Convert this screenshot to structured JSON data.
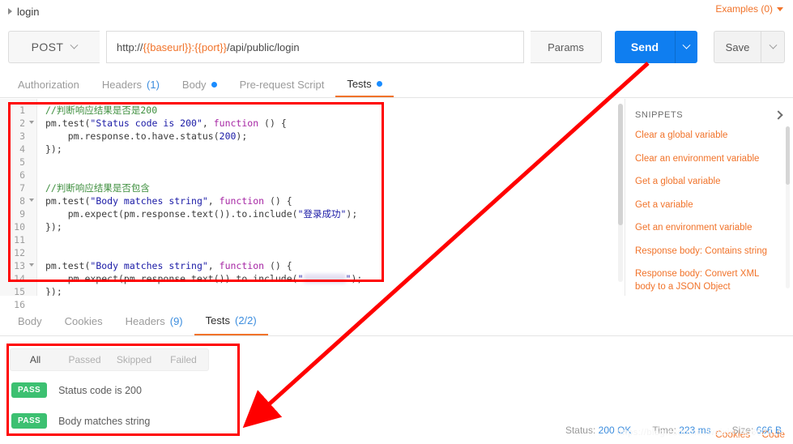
{
  "breadcrumb": {
    "label": "login",
    "caret_icon": "triangle-right-icon"
  },
  "examples": {
    "label": "Examples (0)",
    "caret_icon": "chevron-down-icon"
  },
  "request": {
    "method": "POST",
    "url_prefix": "http://",
    "url_var1": "{{baseurl}}",
    "url_colon": ":",
    "url_var2": "{{port}}",
    "url_suffix": "/api/public/login",
    "params_label": "Params",
    "send_label": "Send",
    "save_label": "Save",
    "accent_blue": "#0f7ef0",
    "accent_orange": "#f1732a"
  },
  "request_tabs": [
    {
      "label": "Authorization",
      "badge": "",
      "dot": false,
      "active": false
    },
    {
      "label": "Headers",
      "badge": "(1)",
      "dot": false,
      "active": false
    },
    {
      "label": "Body",
      "badge": "",
      "dot": true,
      "active": false
    },
    {
      "label": "Pre-request Script",
      "badge": "",
      "dot": false,
      "active": false
    },
    {
      "label": "Tests",
      "badge": "",
      "dot": true,
      "active": true
    }
  ],
  "header_links": [
    {
      "label": "Cookies"
    },
    {
      "label": "Code"
    }
  ],
  "editor": {
    "line_numbers": [
      "1",
      "2",
      "3",
      "4",
      "5",
      "6",
      "7",
      "8",
      "9",
      "10",
      "11",
      "12",
      "13",
      "14",
      "15",
      "16"
    ],
    "fold_lines": [
      2,
      8,
      13
    ],
    "active_line": 16,
    "lines": [
      {
        "n": 1,
        "tokens": [
          {
            "t": "//判断响应结果是否是200",
            "c": "s-cmt"
          }
        ]
      },
      {
        "n": 2,
        "tokens": [
          {
            "t": "pm.test(",
            "c": ""
          },
          {
            "t": "\"Status code is 200\"",
            "c": "s-str"
          },
          {
            "t": ", ",
            "c": ""
          },
          {
            "t": "function",
            "c": "s-kw"
          },
          {
            "t": " () {",
            "c": ""
          }
        ]
      },
      {
        "n": 3,
        "tokens": [
          {
            "t": "    pm.response.to.have.status(",
            "c": ""
          },
          {
            "t": "200",
            "c": "s-num"
          },
          {
            "t": ");",
            "c": ""
          }
        ]
      },
      {
        "n": 4,
        "tokens": [
          {
            "t": "});",
            "c": ""
          }
        ]
      },
      {
        "n": 5,
        "tokens": []
      },
      {
        "n": 6,
        "tokens": []
      },
      {
        "n": 7,
        "tokens": [
          {
            "t": "//判断响应结果是否包含",
            "c": "s-cmt"
          }
        ]
      },
      {
        "n": 8,
        "tokens": [
          {
            "t": "pm.test(",
            "c": ""
          },
          {
            "t": "\"Body matches string\"",
            "c": "s-str"
          },
          {
            "t": ", ",
            "c": ""
          },
          {
            "t": "function",
            "c": "s-kw"
          },
          {
            "t": " () {",
            "c": ""
          }
        ]
      },
      {
        "n": 9,
        "tokens": [
          {
            "t": "    pm.expect(pm.response.text()).to.include(",
            "c": ""
          },
          {
            "t": "\"登录成功\"",
            "c": "s-str"
          },
          {
            "t": ");",
            "c": ""
          }
        ]
      },
      {
        "n": 10,
        "tokens": [
          {
            "t": "});",
            "c": ""
          }
        ]
      },
      {
        "n": 11,
        "tokens": []
      },
      {
        "n": 12,
        "tokens": []
      },
      {
        "n": 13,
        "tokens": [
          {
            "t": "pm.test(",
            "c": ""
          },
          {
            "t": "\"Body matches string\"",
            "c": "s-str"
          },
          {
            "t": ", ",
            "c": ""
          },
          {
            "t": "function",
            "c": "s-kw"
          },
          {
            "t": " () {",
            "c": ""
          }
        ]
      },
      {
        "n": 14,
        "tokens": [
          {
            "t": "    pm.expect(pm.response.text()).to.include(",
            "c": ""
          },
          {
            "t": "\"",
            "c": "s-str"
          },
          {
            "t": "__REDACTED__",
            "c": "blur"
          },
          {
            "t": "\"",
            "c": "s-str"
          },
          {
            "t": ");",
            "c": ""
          }
        ]
      },
      {
        "n": 15,
        "tokens": [
          {
            "t": "});",
            "c": ""
          }
        ]
      },
      {
        "n": 16,
        "tokens": [
          {
            "t": "__CARET__",
            "c": "caret"
          }
        ]
      }
    ]
  },
  "snippets": {
    "title": "SNIPPETS",
    "expand_icon": "chevron-right-icon",
    "items": [
      "Clear a global variable",
      "Clear an environment variable",
      "Get a global variable",
      "Get a variable",
      "Get an environment variable",
      "Response body: Contains string",
      "Response body: Convert XML body to a JSON Object"
    ]
  },
  "response_tabs": [
    {
      "label": "Body",
      "badge": "",
      "active": false
    },
    {
      "label": "Cookies",
      "badge": "",
      "active": false
    },
    {
      "label": "Headers",
      "badge": "(9)",
      "active": false
    },
    {
      "label": "Tests",
      "badge": "(2/2)",
      "active": true
    }
  ],
  "response_meta": {
    "status_label": "Status:",
    "status_value": "200 OK",
    "time_label": "Time:",
    "time_value": "223 ms",
    "size_label": "Size:",
    "size_value": "666 B"
  },
  "result_filters": [
    {
      "label": "All",
      "active": true
    },
    {
      "label": "Passed",
      "active": false
    },
    {
      "label": "Skipped",
      "active": false
    },
    {
      "label": "Failed",
      "active": false
    }
  ],
  "test_results": [
    {
      "status": "PASS",
      "name": "Status code is 200"
    },
    {
      "status": "PASS",
      "name": "Body matches string"
    }
  ],
  "annotations": {
    "highlight_color": "#ff0000",
    "arrow_from": "send-button",
    "arrow_to": "test-results-box"
  },
  "watermark": {
    "text": "https://blog.csdn.net/weixin_46662419"
  }
}
